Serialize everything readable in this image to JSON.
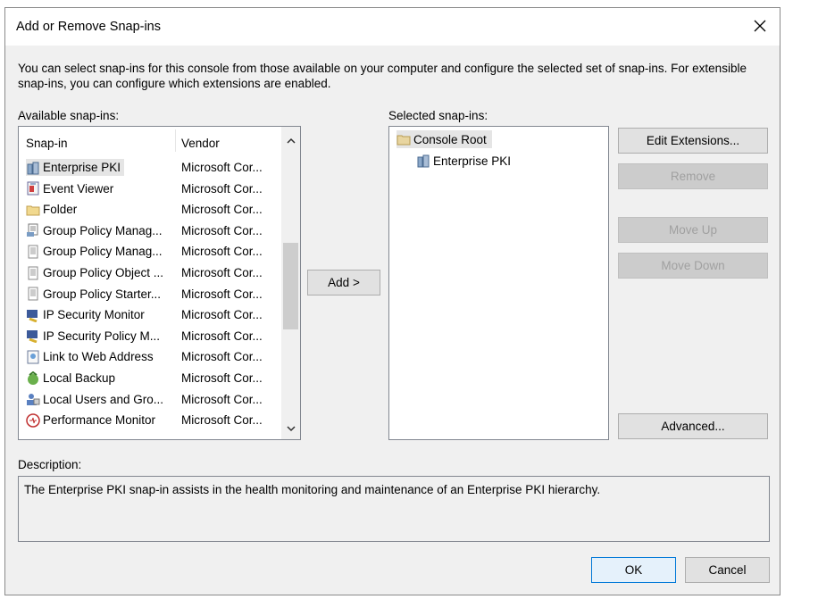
{
  "window": {
    "title": "Add or Remove Snap-ins"
  },
  "intro_text": "You can select snap-ins for this console from those available on your computer and configure the selected set of snap-ins. For extensible snap-ins, you can configure which extensions are enabled.",
  "available": {
    "label": "Available snap-ins:",
    "columns": {
      "name": "Snap-in",
      "vendor": "Vendor"
    },
    "items": [
      {
        "name": "Enterprise PKI",
        "vendor": "Microsoft Cor...",
        "icon": "enterprise-pki-icon",
        "selected": true
      },
      {
        "name": "Event Viewer",
        "vendor": "Microsoft Cor...",
        "icon": "event-viewer-icon"
      },
      {
        "name": "Folder",
        "vendor": "Microsoft Cor...",
        "icon": "folder-icon"
      },
      {
        "name": "Group Policy Manag...",
        "vendor": "Microsoft Cor...",
        "icon": "group-policy-management-icon"
      },
      {
        "name": "Group Policy Manag...",
        "vendor": "Microsoft Cor...",
        "icon": "group-policy-editor-icon"
      },
      {
        "name": "Group Policy Object ...",
        "vendor": "Microsoft Cor...",
        "icon": "group-policy-object-icon"
      },
      {
        "name": "Group Policy Starter...",
        "vendor": "Microsoft Cor...",
        "icon": "group-policy-starter-icon"
      },
      {
        "name": "IP Security Monitor",
        "vendor": "Microsoft Cor...",
        "icon": "ip-security-monitor-icon"
      },
      {
        "name": "IP Security Policy M...",
        "vendor": "Microsoft Cor...",
        "icon": "ip-security-policy-icon"
      },
      {
        "name": "Link to Web Address",
        "vendor": "Microsoft Cor...",
        "icon": "web-link-icon"
      },
      {
        "name": "Local Backup",
        "vendor": "Microsoft Cor...",
        "icon": "local-backup-icon"
      },
      {
        "name": "Local Users and Gro...",
        "vendor": "Microsoft Cor...",
        "icon": "local-users-icon"
      },
      {
        "name": "Performance Monitor",
        "vendor": "Microsoft Cor...",
        "icon": "performance-monitor-icon"
      }
    ]
  },
  "add_button": "Add >",
  "selected": {
    "label": "Selected snap-ins:",
    "root": "Console Root",
    "children": [
      "Enterprise PKI"
    ]
  },
  "buttons": {
    "edit_extensions": "Edit Extensions...",
    "remove": "Remove",
    "move_up": "Move Up",
    "move_down": "Move Down",
    "advanced": "Advanced...",
    "ok": "OK",
    "cancel": "Cancel"
  },
  "description": {
    "label": "Description:",
    "text": "The Enterprise PKI snap-in assists in the health monitoring and maintenance of an Enterprise PKI hierarchy."
  }
}
